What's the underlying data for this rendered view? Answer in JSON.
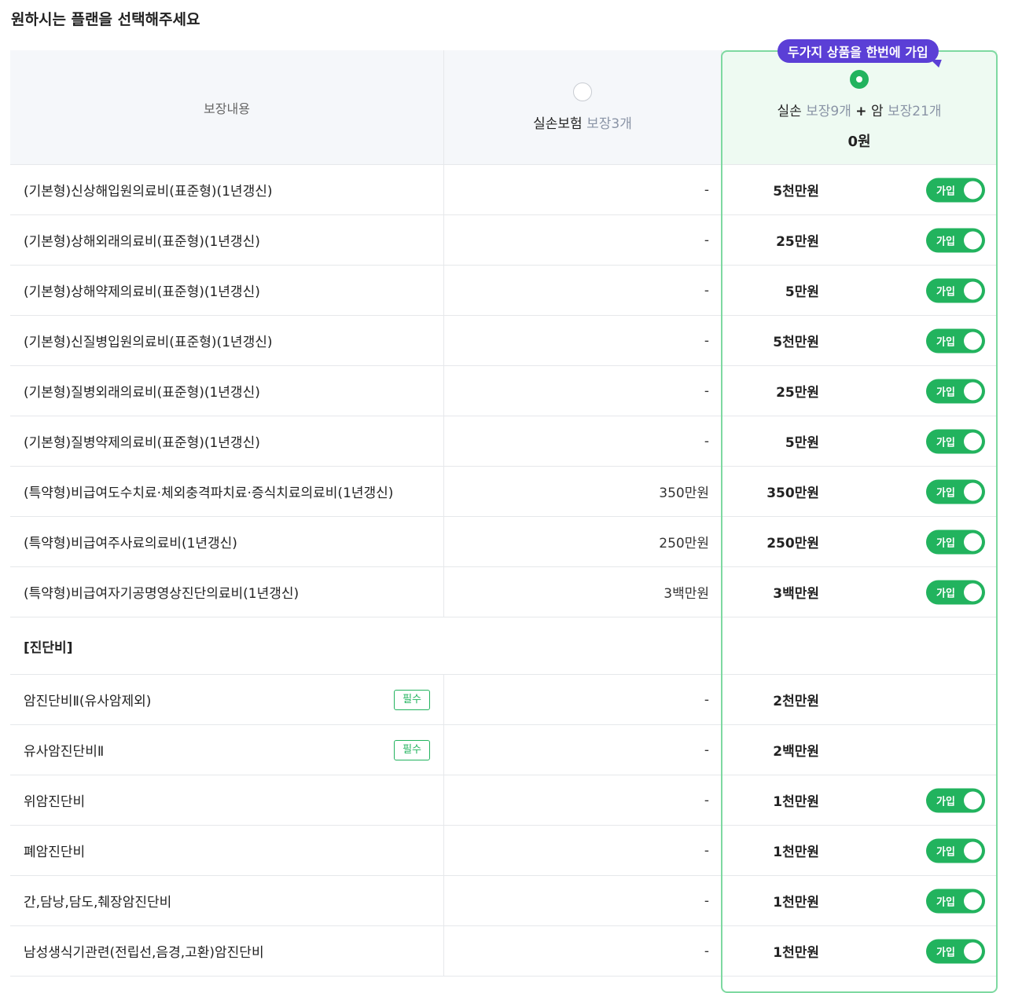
{
  "page_title": "원하시는 플랜을 선택해주세요",
  "header": {
    "col_coverage": "보장내용",
    "plan_a": {
      "name": "실손보험",
      "sub": "보장3개"
    },
    "plan_b": {
      "name1": "실손",
      "sub1": "보장9개",
      "plus": "+",
      "name2": "암",
      "sub2": "보장21개",
      "price": "0원",
      "badge": "두가지 상품을 한번에 가입"
    }
  },
  "toggle_label": "가입",
  "required_label": "필수",
  "rows": [
    {
      "name": "(기본형)신상해입원의료비(표준형)(1년갱신)",
      "a": "-",
      "b": "5천만원"
    },
    {
      "name": "(기본형)상해외래의료비(표준형)(1년갱신)",
      "a": "-",
      "b": "25만원"
    },
    {
      "name": "(기본형)상해약제의료비(표준형)(1년갱신)",
      "a": "-",
      "b": "5만원"
    },
    {
      "name": "(기본형)신질병입원의료비(표준형)(1년갱신)",
      "a": "-",
      "b": "5천만원"
    },
    {
      "name": "(기본형)질병외래의료비(표준형)(1년갱신)",
      "a": "-",
      "b": "25만원"
    },
    {
      "name": "(기본형)질병약제의료비(표준형)(1년갱신)",
      "a": "-",
      "b": "5만원"
    },
    {
      "name": "(특약형)비급여도수치료·체외충격파치료·증식치료의료비(1년갱신)",
      "a": "350만원",
      "b": "350만원"
    },
    {
      "name": "(특약형)비급여주사료의료비(1년갱신)",
      "a": "250만원",
      "b": "250만원"
    },
    {
      "name": "(특약형)비급여자기공명영상진단의료비(1년갱신)",
      "a": "3백만원",
      "b": "3백만원"
    }
  ],
  "section_title": "[진단비]",
  "section_rows": [
    {
      "name": "암진단비Ⅱ(유사암제외)",
      "a": "-",
      "b": "2천만원"
    },
    {
      "name": "유사암진단비Ⅱ",
      "a": "-",
      "b": "2백만원"
    },
    {
      "name": "위암진단비",
      "a": "-",
      "b": "1천만원"
    },
    {
      "name": "폐암진단비",
      "a": "-",
      "b": "1천만원"
    },
    {
      "name": "간,담낭,담도,췌장암진단비",
      "a": "-",
      "b": "1천만원"
    },
    {
      "name": "남성생식기관련(전립선,음경,고환)암진단비",
      "a": "-",
      "b": "1천만원"
    }
  ]
}
